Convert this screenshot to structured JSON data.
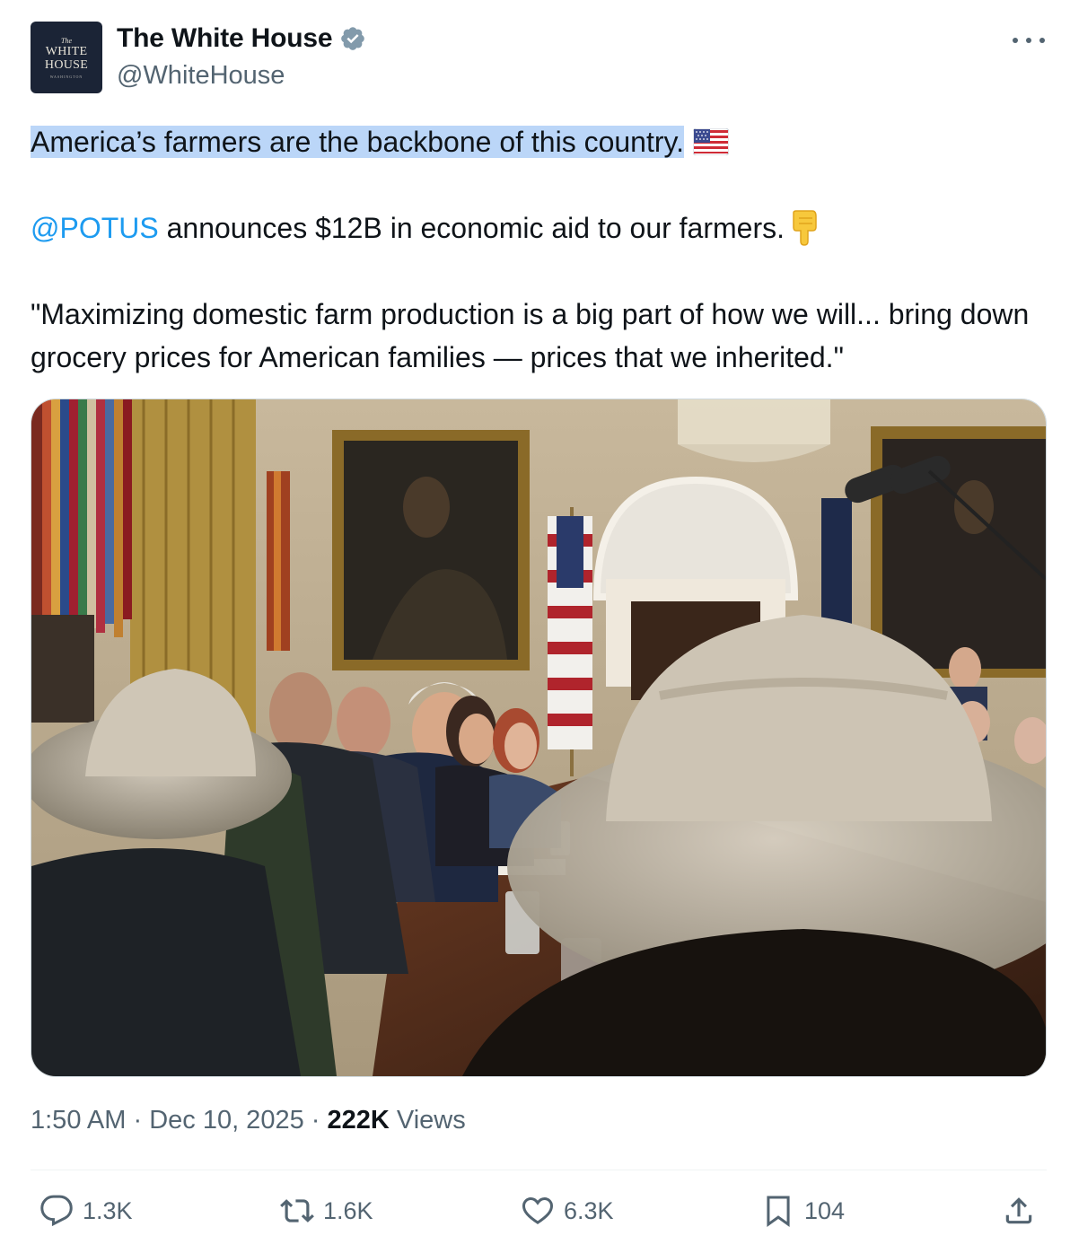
{
  "author": {
    "avatar_line1": "The",
    "avatar_line2": "WHITE",
    "avatar_line3": "HOUSE",
    "avatar_line4": "WASHINGTON",
    "display_name": "The White House",
    "handle": "@WhiteHouse",
    "verified_color": "#829aab"
  },
  "tweet": {
    "line1": "America’s farmers are the backbone of this country.",
    "flag_icon": "us-flag-emoji",
    "mention": "@POTUS",
    "line2_rest": " announces $12B in economic aid to our farmers.",
    "hand_icon": "pointing-down-emoji",
    "quote": "\"Maximizing domestic farm production is a big part of how we will... bring down grocery prices for American families — prices that we inherited.\""
  },
  "media": {
    "description_icon": "photo"
  },
  "meta": {
    "time": "1:50 AM",
    "dot1": " · ",
    "date": "Dec 10, 2025",
    "dot2": " · ",
    "views_count": "222K",
    "views_label": " Views"
  },
  "actions": {
    "replies": "1.3K",
    "reposts": "1.6K",
    "likes": "6.3K",
    "bookmarks": "104"
  },
  "colors": {
    "accent": "#1d9bf0",
    "highlight": "#bbd6f8",
    "muted": "#536471"
  }
}
